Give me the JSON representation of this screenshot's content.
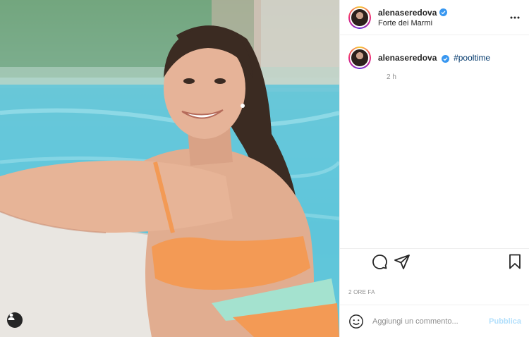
{
  "post": {
    "username": "alenaseredova",
    "verified": true,
    "location": "Forte dei Marmi",
    "caption_hashtag": "#pooltime",
    "caption_time": "2 h",
    "post_time": "2 ORE FA"
  },
  "comment": {
    "placeholder": "Aggiungi un commento...",
    "publish_label": "Pubblica"
  },
  "icons": {
    "header_more": "more-dots-icon",
    "comment": "comment-icon",
    "share": "share-icon",
    "save": "bookmark-icon",
    "emoji": "emoji-icon",
    "user_tags": "user-tag-icon",
    "verified": "verified-badge-icon"
  },
  "colors": {
    "verified_blue": "#3897f0",
    "hashtag": "#00376b",
    "publish_disabled": "#b2dffc",
    "muted": "#8e8e8e"
  }
}
